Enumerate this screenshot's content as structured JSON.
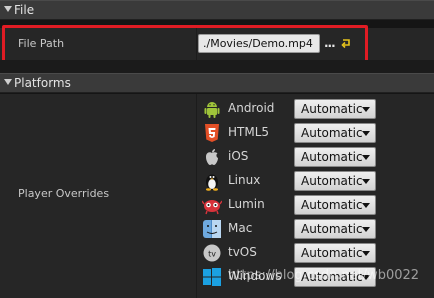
{
  "file_section": {
    "title": "File",
    "file_path_label": "File Path",
    "file_path_value": "./Movies/Demo.mp4",
    "browse_label": "...",
    "reset_icon": "reset-arrow-icon"
  },
  "platforms_section": {
    "title": "Platforms",
    "player_overrides_label": "Player Overrides",
    "items": [
      {
        "name": "Android",
        "value": "Automatic",
        "icon": "android-icon"
      },
      {
        "name": "HTML5",
        "value": "Automatic",
        "icon": "html5-icon"
      },
      {
        "name": "iOS",
        "value": "Automatic",
        "icon": "apple-icon"
      },
      {
        "name": "Linux",
        "value": "Automatic",
        "icon": "tux-icon"
      },
      {
        "name": "Lumin",
        "value": "Automatic",
        "icon": "lumin-icon"
      },
      {
        "name": "Mac",
        "value": "Automatic",
        "icon": "mac-icon"
      },
      {
        "name": "tvOS",
        "value": "Automatic",
        "icon": "tvos-icon"
      },
      {
        "name": "Windows",
        "value": "Automatic",
        "icon": "windows-icon"
      }
    ]
  },
  "watermark": "https://blog.csdn.net/wb0022",
  "colors": {
    "highlight": "#e01c24",
    "background": "#262626",
    "header": "#3a3a3a"
  }
}
